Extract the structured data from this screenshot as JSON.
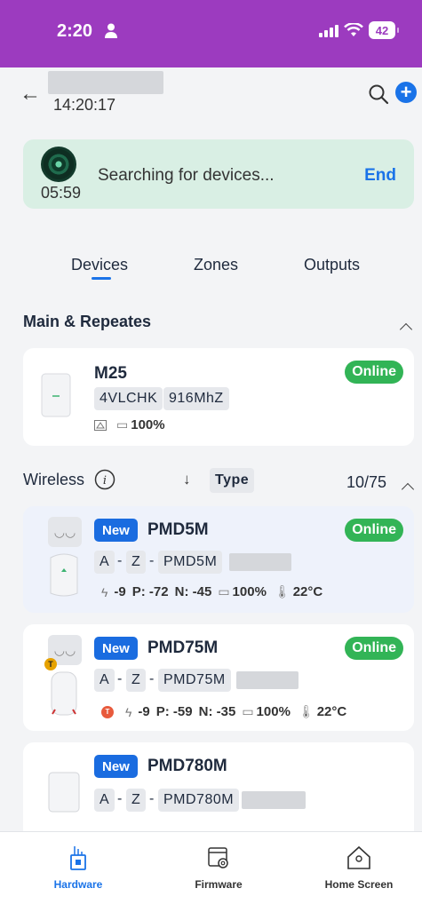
{
  "status_bar": {
    "time": "2:20",
    "battery": "42"
  },
  "header": {
    "time": "14:20:17"
  },
  "search_banner": {
    "text": "Searching for devices...",
    "countdown": "05:59",
    "end_label": "End"
  },
  "tabs": [
    {
      "label": "Devices"
    },
    {
      "label": "Zones"
    },
    {
      "label": "Outputs"
    }
  ],
  "main_section": {
    "title": "Main & Repeates",
    "device": {
      "name": "M25",
      "code": "4VLCHK",
      "frequency": "916MhZ",
      "battery": "100%",
      "status": "Online"
    }
  },
  "wireless_section": {
    "title": "Wireless",
    "sort_label": "Type",
    "count": "10/75",
    "devices": [
      {
        "badge": "New",
        "name": "PMD5M",
        "zone_a": "A",
        "zone_z": "Z",
        "model": "PMD5M",
        "signal": "-9",
        "p": "P: -72",
        "n": "N: -45",
        "battery": "100%",
        "temp": "22°C",
        "status": "Online"
      },
      {
        "badge": "New",
        "name": "PMD75M",
        "zone_a": "A",
        "zone_z": "Z",
        "model": "PMD75M",
        "signal": "-9",
        "p": "P: -59",
        "n": "N: -35",
        "battery": "100%",
        "temp": "22°C",
        "status": "Online"
      },
      {
        "badge": "New",
        "name": "PMD780M",
        "zone_a": "A",
        "zone_z": "Z",
        "model": "PMD780M"
      }
    ]
  },
  "bottom_nav": [
    {
      "label": "Hardware"
    },
    {
      "label": "Firmware"
    },
    {
      "label": "Home Screen"
    }
  ],
  "colors": {
    "status_bar": "#9c3bbf",
    "accent": "#1a73e8",
    "online": "#32b456",
    "banner": "#d9efe4"
  }
}
